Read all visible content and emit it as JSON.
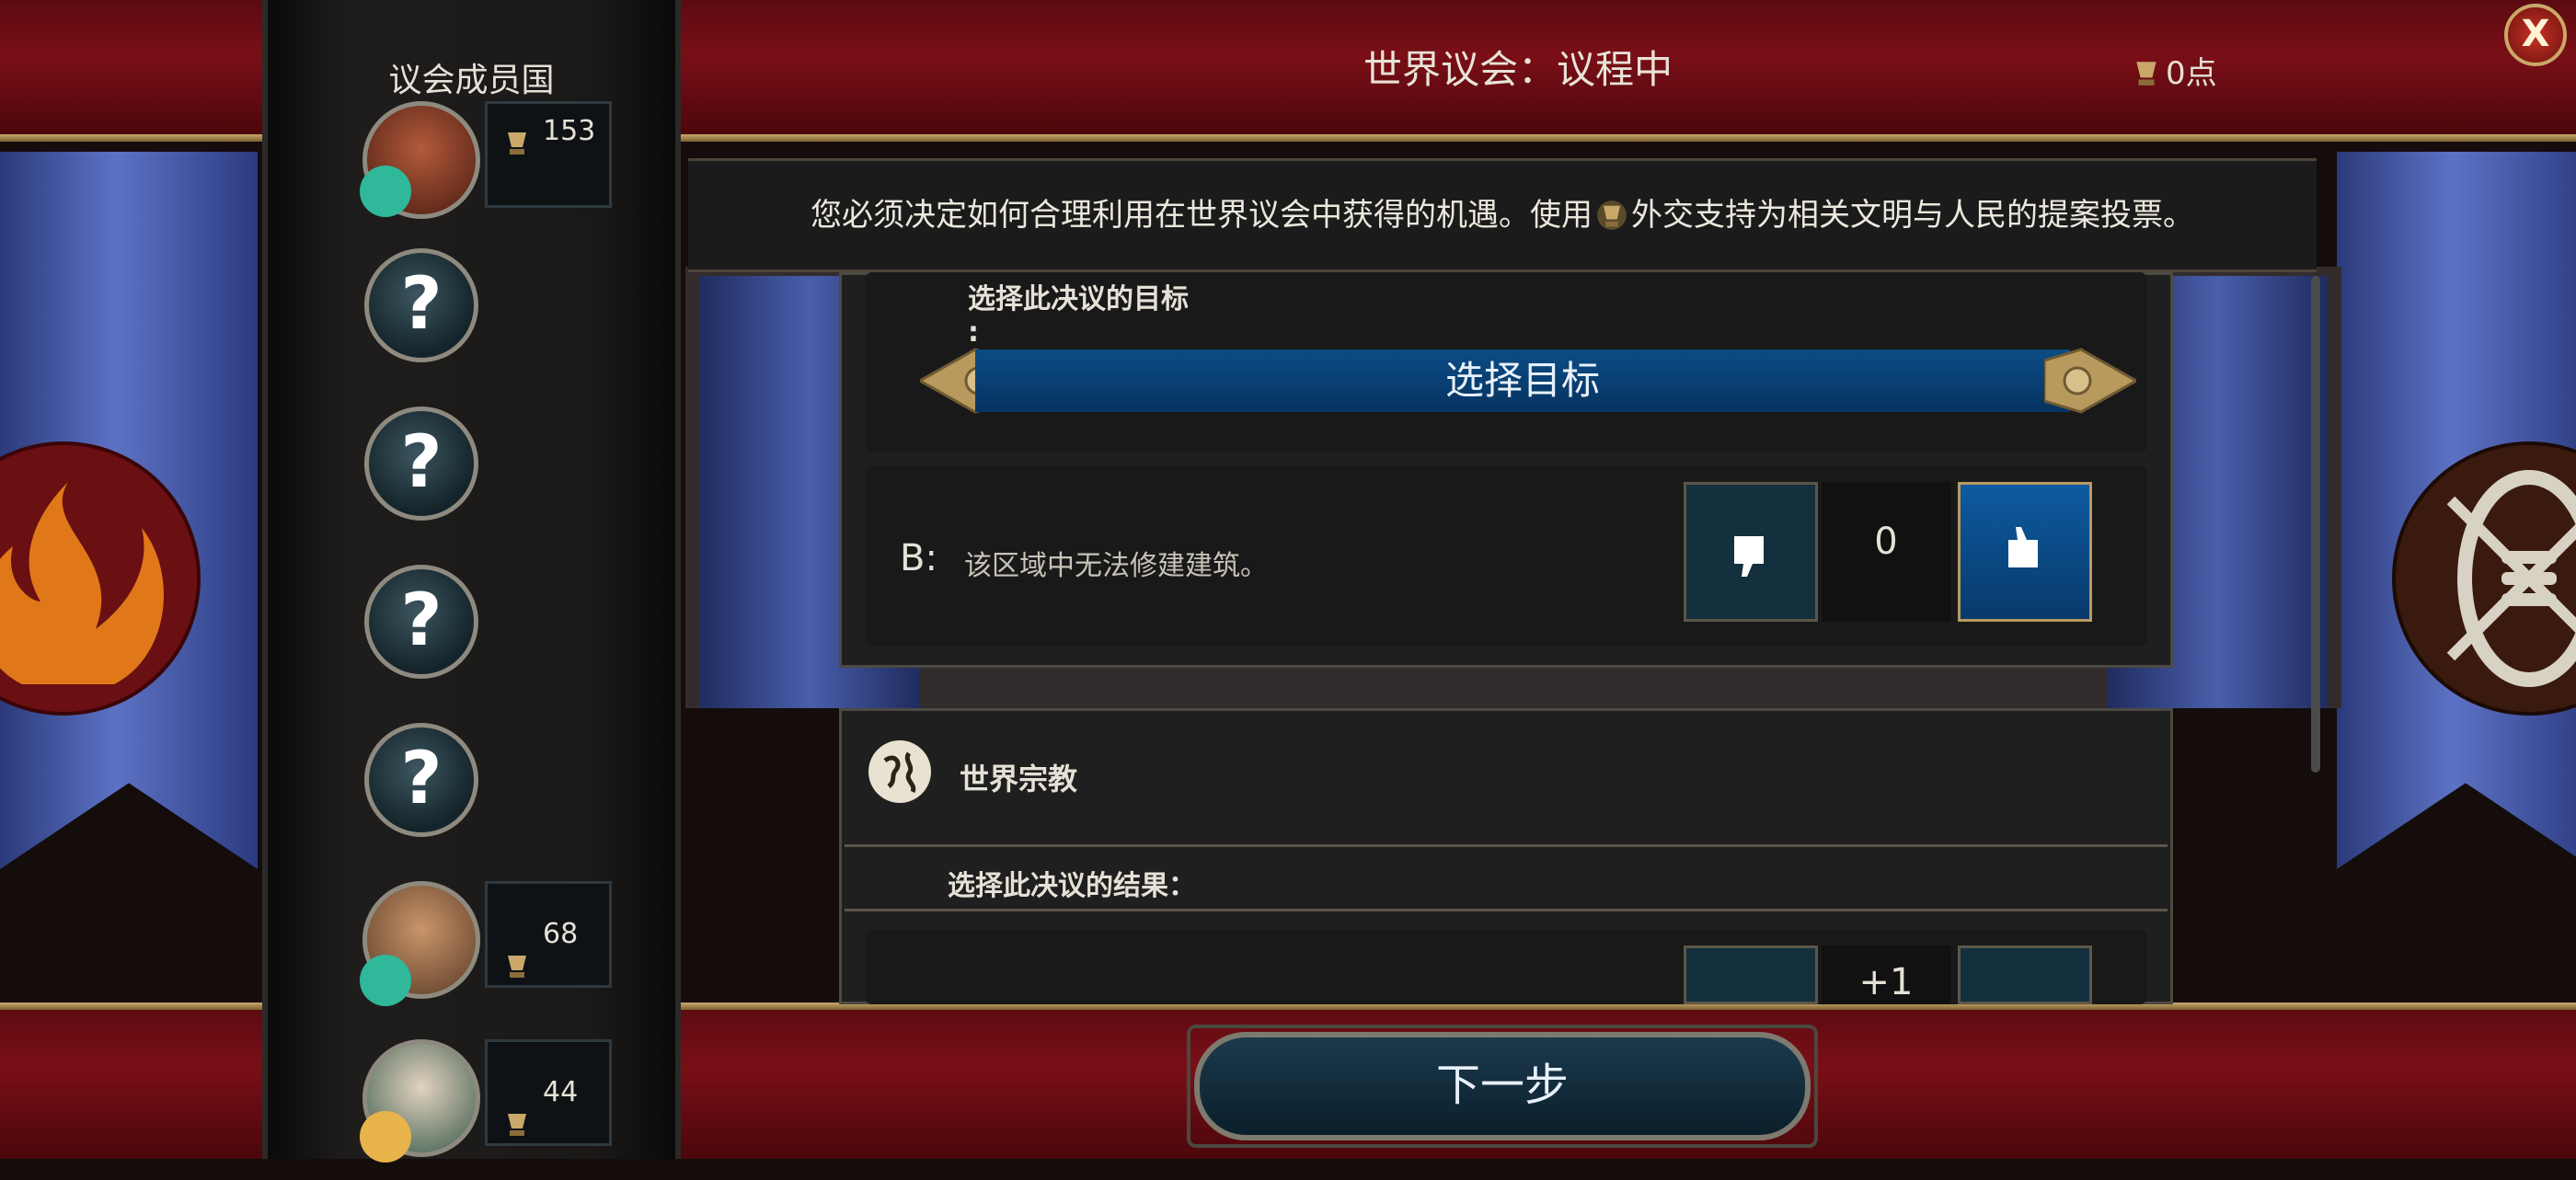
{
  "header": {
    "title": "世界议会：议程中",
    "points": "0点"
  },
  "close_button": {
    "label": "X"
  },
  "sidebar": {
    "title": "议会成员国",
    "members": [
      {
        "votes": "153",
        "known": true
      },
      {
        "label": "?",
        "known": false
      },
      {
        "label": "?",
        "known": false
      },
      {
        "label": "?",
        "known": false
      },
      {
        "label": "?",
        "known": false
      },
      {
        "votes": "68",
        "known": true
      },
      {
        "votes": "44",
        "known": true
      }
    ]
  },
  "instruction": {
    "before": "您必须决定如何合理利用在世界议会中获得的机遇。使用",
    "after": "外交支持为相关文明与人民的提案投票。"
  },
  "resolution1": {
    "target_label": "选择此决议的目标",
    "target_colon": ":",
    "target_button": "选择目标",
    "option_b_letter": "B:",
    "option_b_text": "该区域中无法修建建筑。",
    "vote_count": "0"
  },
  "resolution2": {
    "title": "世界宗教",
    "subtitle": "选择此决议的结果：",
    "vote_count": "+1"
  },
  "next_button": {
    "label": "下一步"
  },
  "colors": {
    "accent_blue": "#0b4c86",
    "top_red": "#7a0f16",
    "gold": "#c9a86a"
  }
}
